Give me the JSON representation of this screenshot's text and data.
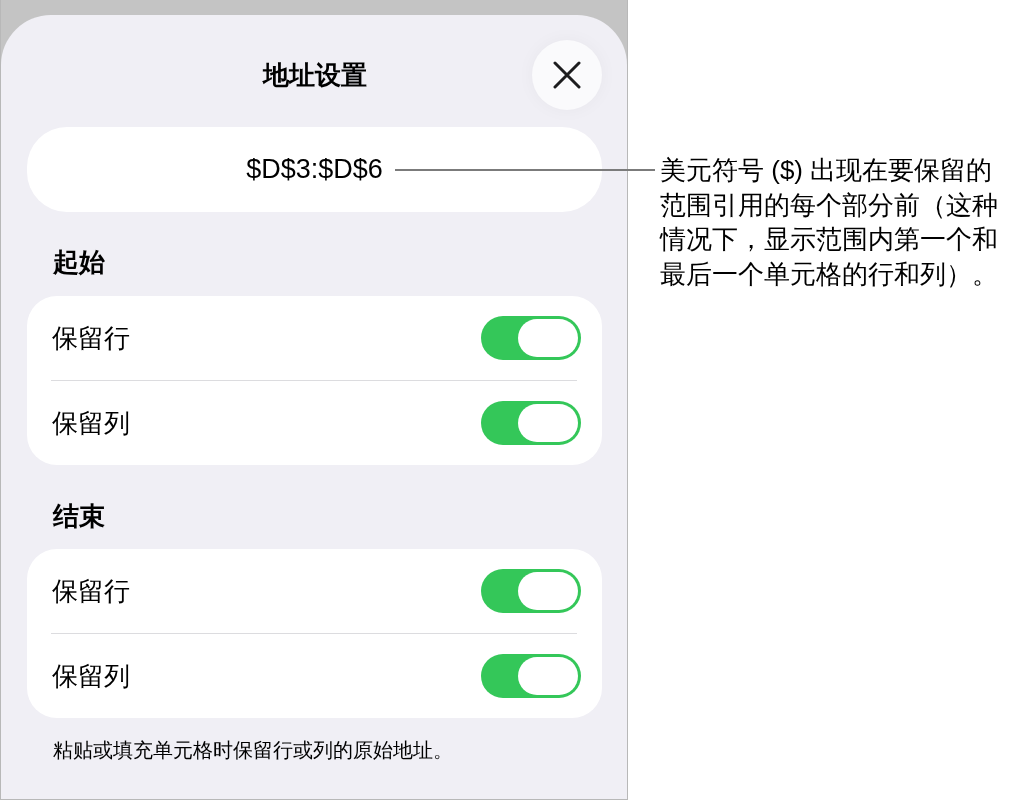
{
  "sheet": {
    "title": "地址设置"
  },
  "address_field": {
    "value": "$D$3:$D$6"
  },
  "sections": [
    {
      "header": "起始",
      "rows": [
        {
          "label": "保留行",
          "on": true
        },
        {
          "label": "保留列",
          "on": true
        }
      ]
    },
    {
      "header": "结束",
      "rows": [
        {
          "label": "保留行",
          "on": true
        },
        {
          "label": "保留列",
          "on": true
        }
      ]
    }
  ],
  "footnote": "粘贴或填充单元格时保留行或列的原始地址。",
  "callout": {
    "text": "美元符号 ($) 出现在要保留的范围引用的每个部分前（这种情况下，显示范围内第一个和最后一个单元格的行和列）。"
  }
}
